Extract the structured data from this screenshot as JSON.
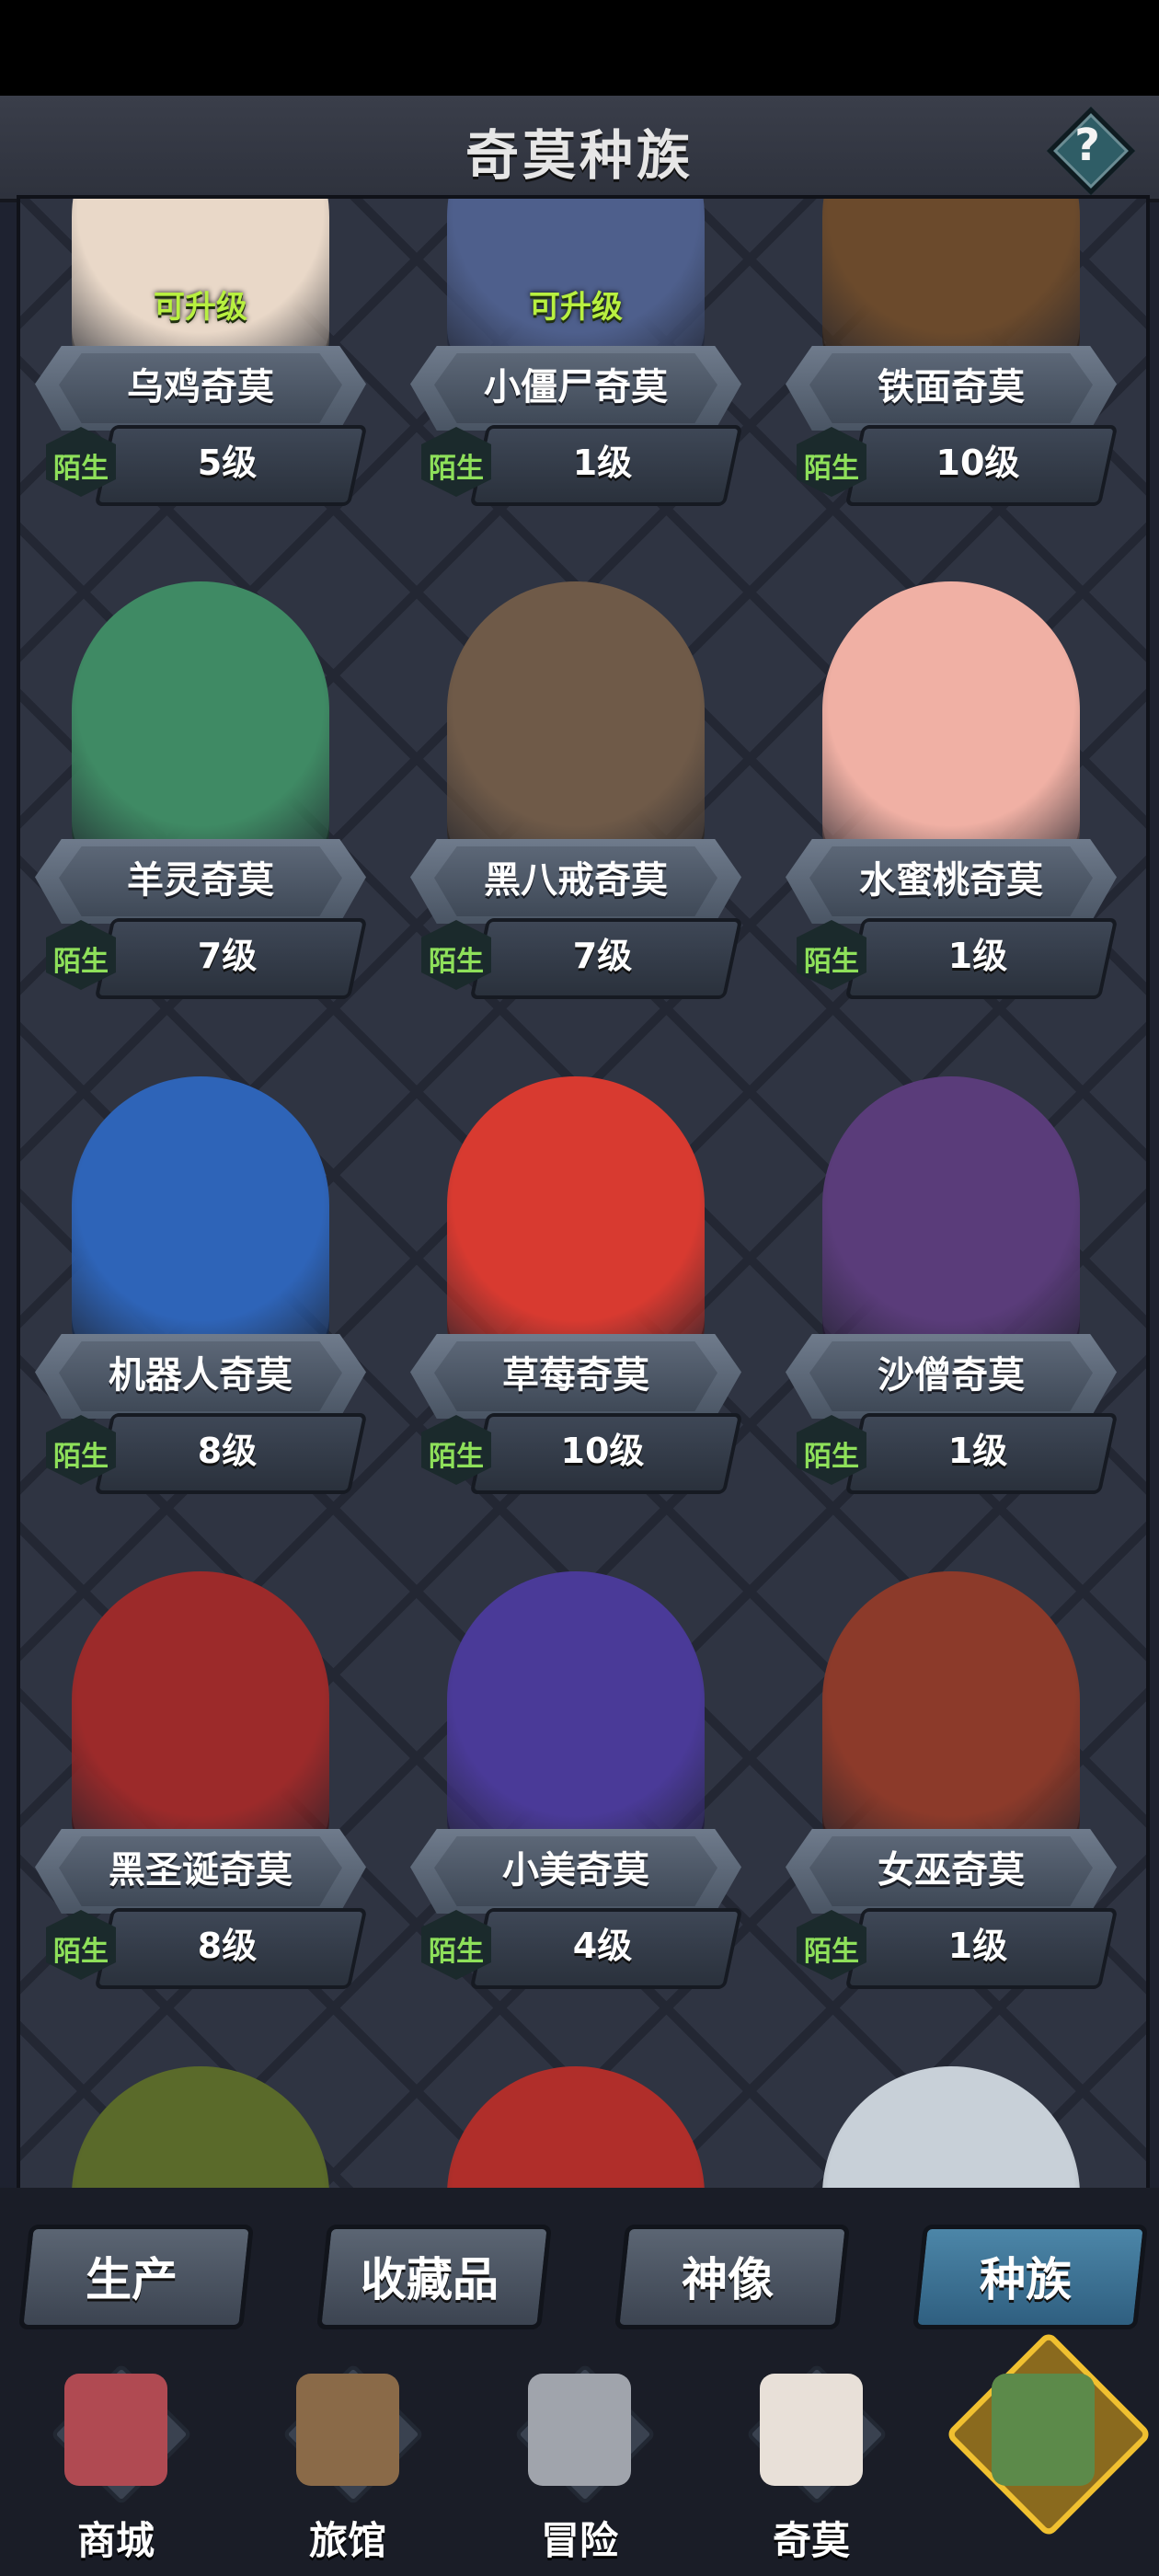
{
  "header": {
    "title": "奇莫种族",
    "help_symbol": "?"
  },
  "grid": {
    "cards": [
      {
        "name": "乌鸡奇莫",
        "level": "5级",
        "relation": "陌生",
        "upgrade": "可升级",
        "accent": "#e9d8c8"
      },
      {
        "name": "小僵尸奇莫",
        "level": "1级",
        "relation": "陌生",
        "upgrade": "可升级",
        "accent": "#4e5f8c"
      },
      {
        "name": "铁面奇莫",
        "level": "10级",
        "relation": "陌生",
        "upgrade": "",
        "accent": "#6b4a2c"
      },
      {
        "name": "羊灵奇莫",
        "level": "7级",
        "relation": "陌生",
        "upgrade": "",
        "accent": "#3f8a64"
      },
      {
        "name": "黑八戒奇莫",
        "level": "7级",
        "relation": "陌生",
        "upgrade": "",
        "accent": "#6f5a48"
      },
      {
        "name": "水蜜桃奇莫",
        "level": "1级",
        "relation": "陌生",
        "upgrade": "",
        "accent": "#f0b0a4"
      },
      {
        "name": "机器人奇莫",
        "level": "8级",
        "relation": "陌生",
        "upgrade": "",
        "accent": "#2e64b8"
      },
      {
        "name": "草莓奇莫",
        "level": "10级",
        "relation": "陌生",
        "upgrade": "",
        "accent": "#d83a30"
      },
      {
        "name": "沙僧奇莫",
        "level": "1级",
        "relation": "陌生",
        "upgrade": "",
        "accent": "#5a3c7a"
      },
      {
        "name": "黑圣诞奇莫",
        "level": "8级",
        "relation": "陌生",
        "upgrade": "",
        "accent": "#9c2a2a"
      },
      {
        "name": "小美奇莫",
        "level": "4级",
        "relation": "陌生",
        "upgrade": "",
        "accent": "#4a3a98"
      },
      {
        "name": "女巫奇莫",
        "level": "1级",
        "relation": "陌生",
        "upgrade": "",
        "accent": "#8c3a2a"
      }
    ],
    "partial_cards": [
      {
        "accent": "#5a6a2a"
      },
      {
        "accent": "#b02e2a"
      },
      {
        "accent": "#c8d0d8"
      }
    ]
  },
  "tabs": [
    {
      "label": "生产",
      "active": false
    },
    {
      "label": "收藏品",
      "active": false
    },
    {
      "label": "神像",
      "active": false
    },
    {
      "label": "种族",
      "active": true
    }
  ],
  "bottom_nav": [
    {
      "label": "商城",
      "icon": "shop-icon",
      "color": "#b04a52"
    },
    {
      "label": "旅馆",
      "icon": "inn-gate-icon",
      "color": "#8a6a48"
    },
    {
      "label": "冒险",
      "icon": "crossed-swords-icon",
      "color": "#a0a4ac"
    },
    {
      "label": "奇莫",
      "icon": "qimo-character-icon",
      "color": "#e8e0d8"
    },
    {
      "label": "",
      "icon": "floating-island-icon",
      "color": "#5c8a4a"
    }
  ]
}
